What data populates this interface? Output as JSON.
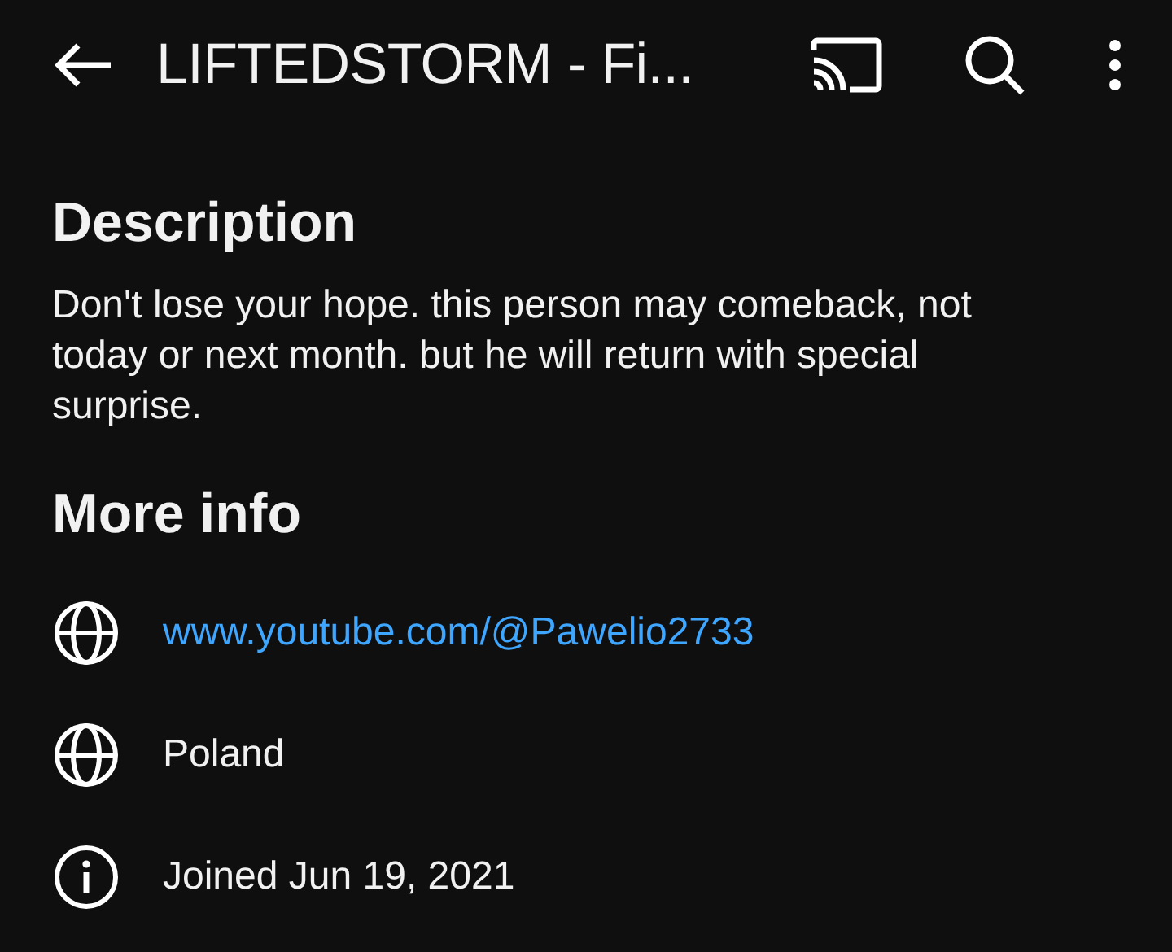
{
  "app_bar": {
    "title": "LIFTEDSTORM - Fi..."
  },
  "description": {
    "heading": "Description",
    "text": "Don't lose your hope. this person may comeback, not today or next month. but he will return with special surprise."
  },
  "more_info": {
    "heading": "More info",
    "items": [
      {
        "kind": "link",
        "text": "www.youtube.com/@Pawelio2733"
      },
      {
        "kind": "country",
        "text": "Poland"
      },
      {
        "kind": "joined",
        "text": "Joined Jun 19, 2021"
      }
    ]
  }
}
